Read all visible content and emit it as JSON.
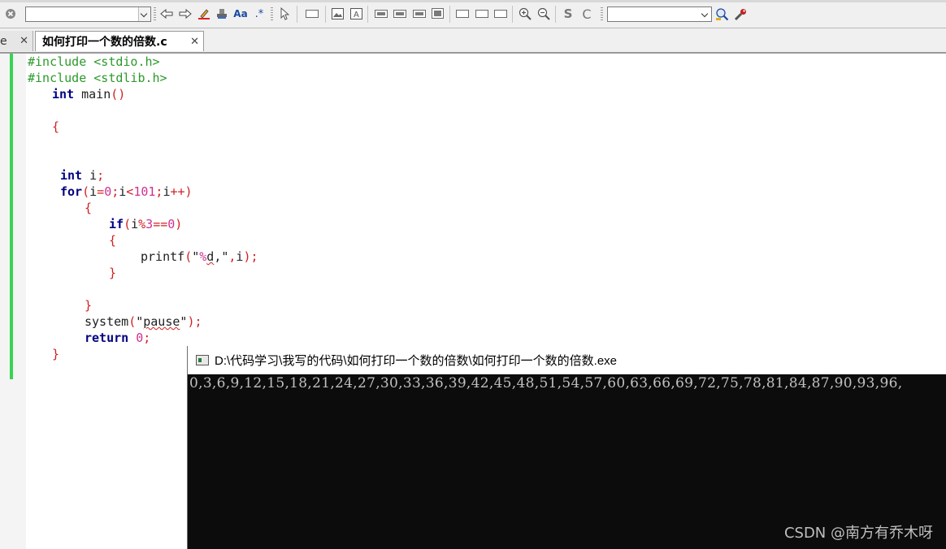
{
  "toolbar": {
    "search_value": "",
    "find_value": "",
    "icons": [
      "clear-icon",
      "back-arrow-icon",
      "forward-arrow-icon",
      "highlight-icon",
      "stamp-icon",
      "font-icon",
      "regex-icon",
      "pointer-icon",
      "rect-icon",
      "image-icon",
      "text-frame-icon",
      "align-top-icon",
      "align-middle-icon",
      "align-bottom-icon",
      "align-fill-icon",
      "frame-left-icon",
      "frame-center-icon",
      "frame-right-icon",
      "zoom-in-icon",
      "zoom-out-icon",
      "s-icon",
      "c-icon",
      "search-icon",
      "wrench-icon"
    ]
  },
  "tabs": {
    "prev_label": "e",
    "active_label": "如何打印一个数的倍数.c",
    "close_glyph": "✕"
  },
  "code": {
    "l1": "#include <stdio.h>",
    "l2": "#include <stdlib.h>",
    "l3_kw": "int",
    "l3_id": " main",
    "l3_op": "()",
    "l4": "{",
    "l5_kw": "int",
    "l5_rest": " i",
    "l5_semi": ";",
    "l6_kw": "for",
    "l6_a": "(",
    "l6_b": "i",
    "l6_c": "=",
    "l6_d": "0",
    "l6_e": ";",
    "l6_f": "i",
    "l6_g": "<",
    "l6_h": "101",
    "l6_i": ";",
    "l6_j": "i",
    "l6_k": "++)",
    "l7": "{",
    "l8_kw": "if",
    "l8_a": "(",
    "l8_b": "i",
    "l8_c": "%",
    "l8_d": "3",
    "l8_e": "==",
    "l8_f": "0",
    "l8_g": ")",
    "l9": "{",
    "l10_a": "printf",
    "l10_b": "(",
    "l10_c": "\"",
    "l10_d": "%",
    "l10_e": "d",
    "l10_f": ",\"",
    "l10_g": ",",
    "l10_h": "i",
    "l10_i": ");",
    "l11": "}",
    "l12": "}",
    "l13_a": "system",
    "l13_b": "(",
    "l13_c": "\"",
    "l13_d": "pause",
    "l13_e": "\"",
    "l13_f": ");",
    "l14_kw": "return",
    "l14_a": " ",
    "l14_b": "0",
    "l14_c": ";",
    "l15": "}"
  },
  "console": {
    "title": "D:\\代码学习\\我写的代码\\如何打印一个数的倍数\\如何打印一个数的倍数.exe",
    "output": "0,3,6,9,12,15,18,21,24,27,30,33,36,39,42,45,48,51,54,57,60,63,66,69,72,75,78,81,84,87,90,93,96,",
    "watermark": "CSDN @南方有乔木呀"
  }
}
